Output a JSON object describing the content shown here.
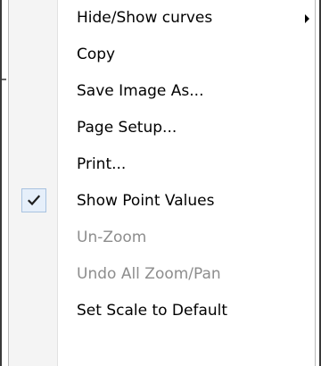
{
  "menu": {
    "items": [
      {
        "label": "Hide/Show curves",
        "enabled": true,
        "submenu": true,
        "checked": false
      },
      {
        "label": "Copy",
        "enabled": true,
        "submenu": false,
        "checked": false
      },
      {
        "label": "Save Image As...",
        "enabled": true,
        "submenu": false,
        "checked": false
      },
      {
        "label": "Page Setup...",
        "enabled": true,
        "submenu": false,
        "checked": false
      },
      {
        "label": "Print...",
        "enabled": true,
        "submenu": false,
        "checked": false
      },
      {
        "label": "Show Point Values",
        "enabled": true,
        "submenu": false,
        "checked": true
      },
      {
        "label": "Un-Zoom",
        "enabled": false,
        "submenu": false,
        "checked": false
      },
      {
        "label": "Undo All Zoom/Pan",
        "enabled": false,
        "submenu": false,
        "checked": false
      },
      {
        "label": "Set Scale to Default",
        "enabled": true,
        "submenu": false,
        "checked": false
      }
    ]
  },
  "colors": {
    "enabled_text": "#000000",
    "disabled_text": "#8d8d8d",
    "check_highlight": "#e6effa"
  },
  "icons": {
    "submenu": "chevron-right-icon",
    "check": "checkmark-icon"
  }
}
